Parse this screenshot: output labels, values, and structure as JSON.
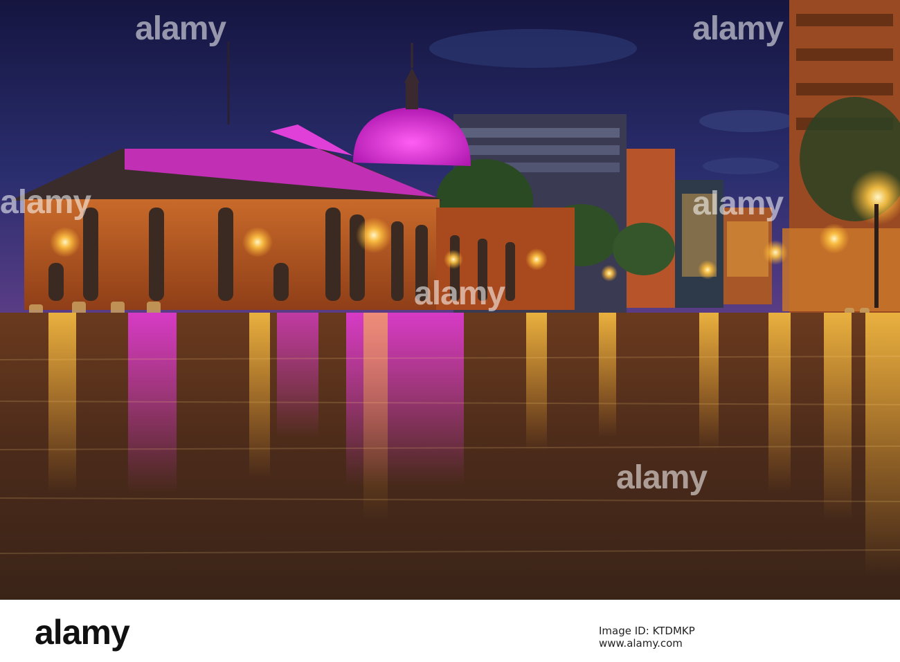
{
  "photo": {
    "description_colors": {
      "sky_top": "#1c1a4a",
      "sky_bottom": "#5a3f8a",
      "brick": "#b5521e",
      "dome_glow": "#e02cd8",
      "lamp_glow": "#ffc545",
      "water": "#4a2c1a"
    },
    "watermarks": [
      "alamy",
      "alamy",
      "alamy",
      "alamy",
      "alamy",
      "alamy"
    ]
  },
  "footer": {
    "logo": "alamy",
    "image_id_label": "Image ID:",
    "image_id": "KTDMKP",
    "url": "www.alamy.com"
  }
}
